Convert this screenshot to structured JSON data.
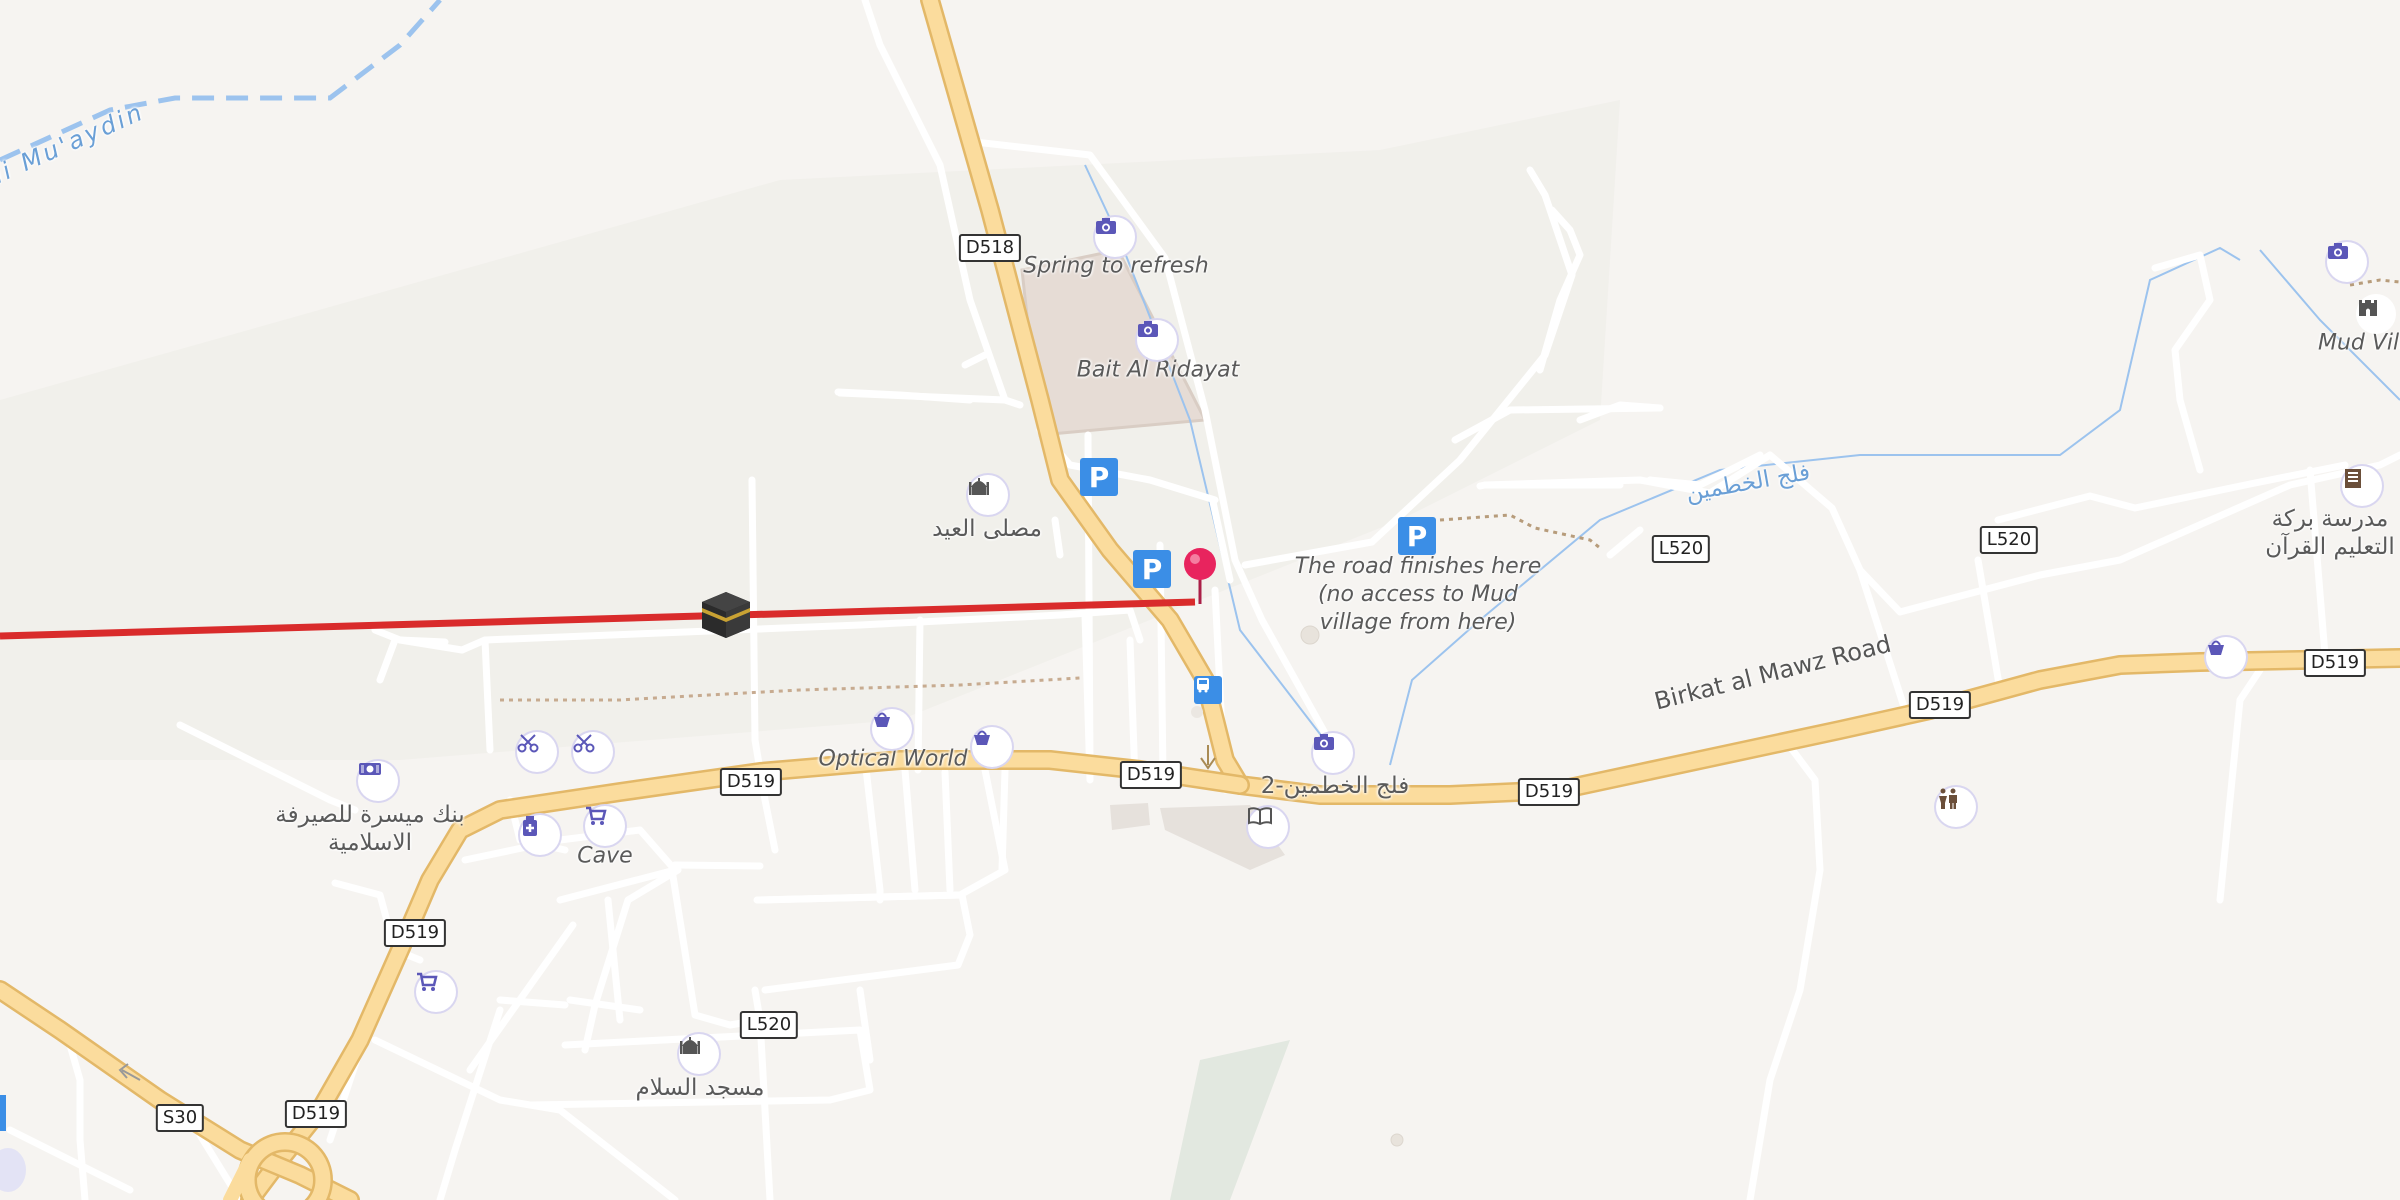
{
  "map": {
    "route_color": "#d92b2b",
    "road_major_color": "#f9d38a",
    "water_color": "#9cc3ee",
    "poi_color": "#5b57b8",
    "parking_color": "#3b8ee6",
    "pin_color": "#e8245e"
  },
  "labels": {
    "wadi": "di Mu'aydin",
    "spring": "Spring to refresh",
    "bait": "Bait Al Ridayat",
    "musalla": "مصلى العيد",
    "road_finishes": "The road finishes here (no access to Mud village from here)",
    "optical": "Optical World",
    "falaj_alkhatmeen_2": "فلج الخطمين-2",
    "falaj_alkhatmeen": "فلج الخطمين",
    "bank": "بنك ميسرة للصيرفة الاسلامية",
    "cave": "Cave",
    "masjid": "مسجد السلام",
    "birkat": "Birkat al Mawz Road",
    "mud_village": "Mud Vill",
    "school": "مدرسة بركة التعليم القرآن"
  },
  "shields": {
    "d518": "D518",
    "d519_a": "D519",
    "d519_b": "D519",
    "d519_c": "D519",
    "d519_d": "D519",
    "d519_e": "D519",
    "d519_f": "D519",
    "d519_g": "D519",
    "l520_a": "L520",
    "l520_b": "L520",
    "l520_c": "L520",
    "s30": "S30"
  },
  "icons": {
    "camera": "camera-icon",
    "mosque": "mosque-icon",
    "parking": "P",
    "bus": "bus-stop-icon",
    "shopping": "shopping-bag-icon",
    "cart": "cart-icon",
    "scissors": "scissors-icon",
    "pharmacy": "pharmacy-icon",
    "bank": "bank-icon",
    "library": "book-icon",
    "kaaba": "kaaba-icon",
    "pin": "location-pin-icon",
    "toilets": "toilets-icon",
    "castle": "castle-icon",
    "school": "school-icon"
  }
}
